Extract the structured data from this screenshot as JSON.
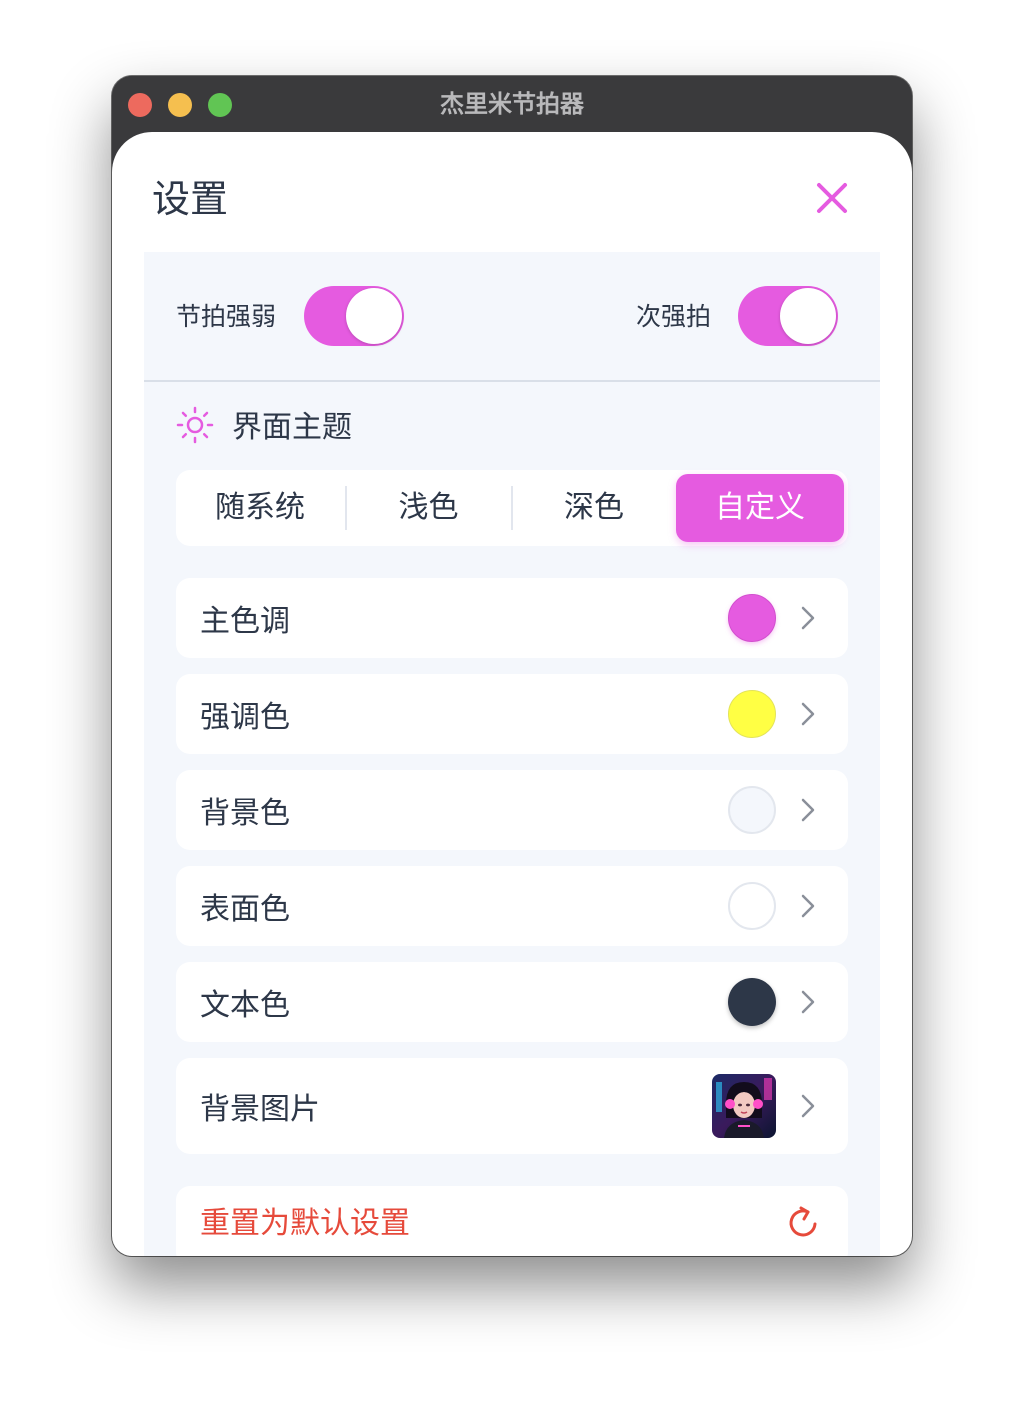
{
  "window": {
    "title": "杰里米节拍器"
  },
  "sheet": {
    "title": "设置",
    "close_icon": "close-icon",
    "accent_color": "#e55be0"
  },
  "toggles": {
    "beat_accent": {
      "label": "节拍强弱",
      "on": true
    },
    "secondary_accent": {
      "label": "次强拍",
      "on": true
    }
  },
  "theme": {
    "section_title": "界面主题",
    "section_icon": "sun-icon",
    "modes": [
      {
        "label": "随系统",
        "active": false
      },
      {
        "label": "浅色",
        "active": false
      },
      {
        "label": "深色",
        "active": false
      },
      {
        "label": "自定义",
        "active": true
      }
    ]
  },
  "custom_colors": [
    {
      "label": "主色调",
      "color": "#e55be0"
    },
    {
      "label": "强调色",
      "color": "#ffff44"
    },
    {
      "label": "背景色",
      "color": "#f4f7fc"
    },
    {
      "label": "表面色",
      "color": "#ffffff"
    },
    {
      "label": "文本色",
      "color": "#2d3748"
    }
  ],
  "background_image": {
    "label": "背景图片",
    "thumbnail": "portrait-thumbnail"
  },
  "reset": {
    "label": "重置为默认设置",
    "icon": "refresh-icon",
    "color": "#e64a3b"
  }
}
